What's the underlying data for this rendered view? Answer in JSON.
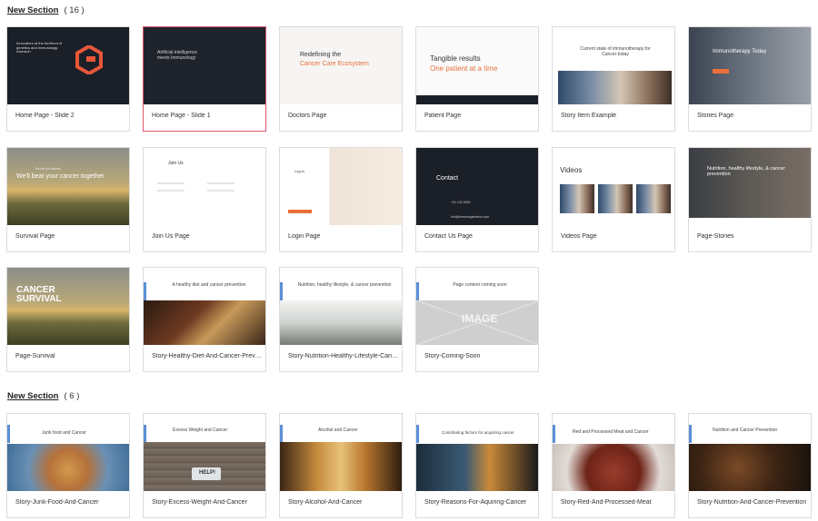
{
  "sections": [
    {
      "title": "New Section",
      "count": "( 16 )",
      "cards": [
        {
          "label": "Home Page - Slide 2"
        },
        {
          "label": "Home Page - Slide 1"
        },
        {
          "label": "Doctors Page"
        },
        {
          "label": "Patient Page"
        },
        {
          "label": "Story Item Example"
        },
        {
          "label": "Stories Page"
        },
        {
          "label": "Survival Page"
        },
        {
          "label": "Join Us Page"
        },
        {
          "label": "Login Page"
        },
        {
          "label": "Contact Us Page"
        },
        {
          "label": "Videos Page"
        },
        {
          "label": "Page-Stories"
        },
        {
          "label": "Page-Survival"
        },
        {
          "label": "Story-Healthy-Diet-And-Cancer-Prevention"
        },
        {
          "label": "Story-Nutrition-Healthy-Lifestyle-Cancer-Prevention"
        },
        {
          "label": "Story-Coming-Soon"
        }
      ]
    },
    {
      "title": "New Section",
      "count": "( 6 )",
      "cards": [
        {
          "label": "Story-Junk-Food-And-Cancer"
        },
        {
          "label": "Story-Excess-Weight-And-Cancer"
        },
        {
          "label": "Story-Alcohol-And-Cancer"
        },
        {
          "label": "Story-Reasons-For-Aquiring-Cancer"
        },
        {
          "label": "Story-Red-And-Processed-Meat"
        },
        {
          "label": "Story-Nutrition-And-Cancer-Prevention"
        }
      ]
    }
  ],
  "thumbs": {
    "home2": "Innovators at the forefront of genetics and immunology research",
    "home1": "Artificial intelligence meets Immunology",
    "doctors_title": "Redefining the",
    "doctors_accent": "Cancer Care Ecosystem",
    "patient_title": "Tangible results",
    "patient_accent": "One patient at a time",
    "story_item": "Current state of immunotherapy for Cancer today",
    "stories": "Immunotherapy Today",
    "survival_small": "You're not alone",
    "survival": "We'll beat your cancer together",
    "join": "Join Us",
    "login": "Log in",
    "contact": "Contact",
    "contact_phone": "+01 134 0000",
    "contact_email": "info@immunogenetics.com",
    "videos": "Videos",
    "page_stories": "Nutrition, healthy lifestyle, & cancer prevention",
    "page_survival": "CANCER SURVIVAL",
    "diet": "A healthy diet and cancer prevention",
    "nutrition": "Nutrition, healthy lifestyle, & cancer prevention",
    "coming_soon": "Page content coming soon",
    "image_placeholder": "IMAGE",
    "junk": "Junk food and Cancer",
    "weight": "Excess Weight and Cancer",
    "weight_scale": "HELP!",
    "alcohol": "Alcohol and Cancer",
    "reasons": "Contributing factors for acquiring cancer",
    "meat": "Red and Processed Meat and Cancer",
    "nut_prev": "Nutrition and Cancer Prevention"
  },
  "colors": {
    "accent": "#e8703a",
    "selected_border": "#e0566d",
    "link_blue": "#5b8fd6"
  }
}
